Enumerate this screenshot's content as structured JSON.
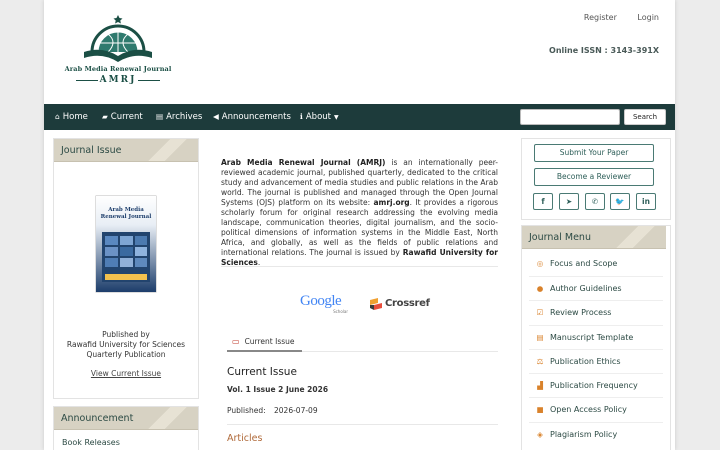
{
  "header": {
    "logo_title": "Arab Media Renewal Journal",
    "logo_abbr": "AMRJ",
    "register": "Register",
    "login": "Login",
    "issn": "Online ISSN : 3143-391X"
  },
  "nav": {
    "items": [
      {
        "label": "Home",
        "icon": "home-icon"
      },
      {
        "label": "Current",
        "icon": "book-icon"
      },
      {
        "label": "Archives",
        "icon": "archive-icon"
      },
      {
        "label": "Announcements",
        "icon": "bullhorn-icon"
      },
      {
        "label": "About",
        "icon": "info-icon"
      }
    ],
    "search_button": "Search",
    "search_placeholder": ""
  },
  "left": {
    "issue_heading": "Journal Issue",
    "cover_title": "Arab Media Renewal Journal",
    "published_by": "Published by",
    "publisher": "Rawafid University for Sciences",
    "frequency": "Quarterly Publication",
    "view_current": "View Current Issue",
    "announcement_heading": "Announcement",
    "book_releases": "Book Releases"
  },
  "center": {
    "about_name": "Arab Media Renewal Journal (AMRJ)",
    "about_p1": " is an internationally peer-reviewed academic journal, published quarterly, dedicated to the critical study and advancement of media studies and public relations in the Arab world. The journal is published and managed through the Open Journal Systems (OJS) platform on its website: ",
    "about_site": "amrj.org",
    "about_p2": ". It provides a rigorous scholarly forum for original research addressing the evolving media landscape, communication theories, digital journalism, and the socio-political dimensions of information systems in the Middle East, North Africa, and globally, as well as the fields of public relations and international relations. The journal is issued by ",
    "about_publisher": "Rawafid University for Sciences",
    "about_end": ".",
    "google": "Google",
    "google_sub": "Scholar",
    "crossref": "Crossref",
    "tab_current": "Current Issue",
    "current_heading": "Current Issue",
    "issue_title": "Vol. 1 Issue 2 June 2026",
    "published_label": "Published:",
    "published_date": "2026-07-09",
    "articles": "Articles"
  },
  "right": {
    "submit": "Submit Your Paper",
    "reviewer": "Become a Reviewer",
    "social": [
      {
        "label": "f",
        "icon": "facebook-icon"
      },
      {
        "label": "➤",
        "icon": "telegram-icon"
      },
      {
        "label": "✆",
        "icon": "whatsapp-icon"
      },
      {
        "label": "🐦",
        "icon": "twitter-icon"
      },
      {
        "label": "in",
        "icon": "linkedin-icon"
      }
    ],
    "menu_heading": "Journal Menu",
    "menu": [
      {
        "label": "Focus and Scope",
        "icon": "target-icon"
      },
      {
        "label": "Author Guidelines",
        "icon": "user-icon"
      },
      {
        "label": "Review Process",
        "icon": "check-icon"
      },
      {
        "label": "Manuscript Template",
        "icon": "document-icon"
      },
      {
        "label": "Publication Ethics",
        "icon": "scale-icon"
      },
      {
        "label": "Publication Frequency",
        "icon": "bar-chart-icon"
      },
      {
        "label": "Open Access Policy",
        "icon": "lock-icon"
      },
      {
        "label": "Plagiarism Policy",
        "icon": "shield-icon"
      }
    ]
  },
  "colors": {
    "nav_bg": "#1d3b3b",
    "accent": "#d9822b",
    "brand": "#1b4f45"
  }
}
